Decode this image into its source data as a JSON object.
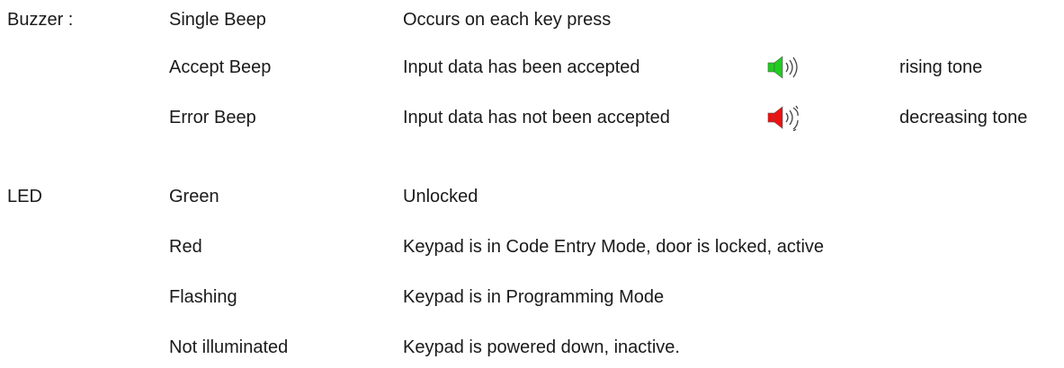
{
  "buzzer": {
    "heading": "Buzzer :",
    "rows": [
      {
        "name": "Single Beep",
        "description": "Occurs on each key press",
        "tone": ""
      },
      {
        "name": "Accept Beep",
        "description": "Input data has been accepted",
        "icon": "green-speaker-icon",
        "icon_color": "#22cc22",
        "tone": "rising tone"
      },
      {
        "name": "Error Beep",
        "description": "Input data has not been accepted",
        "icon": "red-speaker-icon",
        "icon_color": "#ee1111",
        "tone": "decreasing tone"
      }
    ]
  },
  "led": {
    "heading": "LED",
    "rows": [
      {
        "name": "Green",
        "description": "Unlocked"
      },
      {
        "name": "Red",
        "description": "Keypad is in Code Entry Mode, door is locked, active"
      },
      {
        "name": "Flashing",
        "description": "Keypad is in Programming Mode"
      },
      {
        "name": "Not illuminated",
        "description": "Keypad is powered down, inactive."
      }
    ]
  }
}
